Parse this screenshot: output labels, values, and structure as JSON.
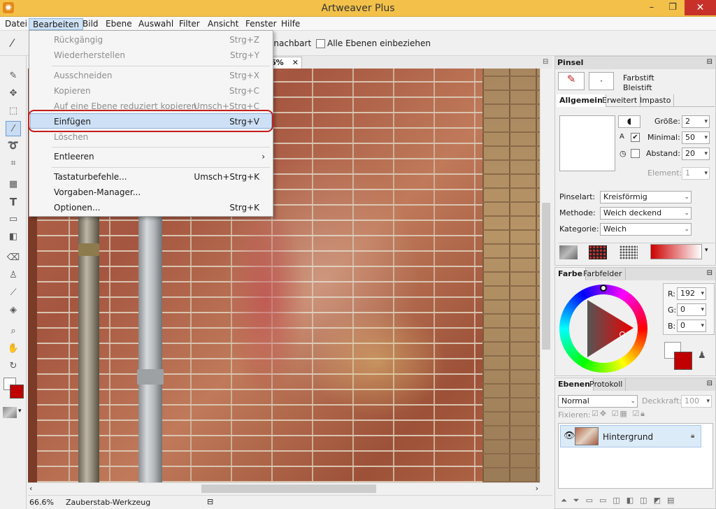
{
  "app": {
    "title": "Artweaver Plus"
  },
  "window_controls": {
    "minimize": "–",
    "maximize": "❐",
    "close": "✕"
  },
  "menubar": [
    "Datei",
    "Bearbeiten",
    "Bild",
    "Ebene",
    "Auswahl",
    "Filter",
    "Ansicht",
    "Fenster",
    "Hilfe"
  ],
  "options_bar": {
    "partial_label": "enachbart",
    "all_layers_label": "Alle Ebenen einbeziehen"
  },
  "document": {
    "tab_label": "6%",
    "close": "✕"
  },
  "status": {
    "zoom": "66.6%",
    "tool_name": "Zauberstab-Werkzeug"
  },
  "edit_menu": {
    "items": [
      {
        "label": "Rückgängig",
        "shortcut": "Strg+Z",
        "enabled": false
      },
      {
        "label": "Wiederherstellen",
        "shortcut": "Strg+Y",
        "enabled": false
      },
      {
        "label": "Ausschneiden",
        "shortcut": "Strg+X",
        "enabled": false
      },
      {
        "label": "Kopieren",
        "shortcut": "Strg+C",
        "enabled": false
      },
      {
        "label": "Auf eine Ebene reduziert kopieren",
        "shortcut": "Umsch+Strg+C",
        "enabled": false
      },
      {
        "label": "Einfügen",
        "shortcut": "Strg+V",
        "enabled": true,
        "highlighted": true
      },
      {
        "label": "Löschen",
        "shortcut": "",
        "enabled": false
      },
      {
        "label": "Entleeren",
        "shortcut": "›",
        "enabled": true
      },
      {
        "label": "Tastaturbefehle...",
        "shortcut": "Umsch+Strg+K",
        "enabled": true
      },
      {
        "label": "Vorgaben-Manager...",
        "shortcut": "",
        "enabled": true
      },
      {
        "label": "Optionen...",
        "shortcut": "Strg+K",
        "enabled": true
      }
    ]
  },
  "brush_panel": {
    "title": "Pinsel",
    "brush_category": "Farbstift",
    "brush_variant": "Bleistift",
    "tabs": [
      "Allgemein",
      "Erweitert",
      "Impasto"
    ],
    "size_label": "Größe:",
    "size_value": "2",
    "minimal_label": "Minimal:",
    "minimal_value": "50",
    "spacing_label": "Abstand:",
    "spacing_value": "20",
    "element_label": "Element:",
    "element_value": "1",
    "brush_type_label": "Pinselart:",
    "brush_type_value": "Kreisförmig",
    "method_label": "Methode:",
    "method_value": "Weich deckend",
    "category_label": "Kategorie:",
    "category_value": "Weich"
  },
  "color_panel": {
    "tabs": [
      "Farbe",
      "Farbfelder"
    ],
    "r_label": "R:",
    "r_value": "192",
    "g_label": "G:",
    "g_value": "0",
    "b_label": "B:",
    "b_value": "0",
    "foreground_color": "#c00000",
    "background_color": "#ffffff"
  },
  "layers_panel": {
    "tabs": [
      "Ebenen",
      "Protokoll"
    ],
    "blend_mode": "Normal",
    "opacity_label": "Deckkraft:",
    "opacity_value": "100",
    "lock_label": "Fixieren:",
    "layers": [
      {
        "name": "Hintergrund"
      }
    ]
  },
  "colors": {
    "accent_highlight": "#cde0f5",
    "callout_ring": "#c41e1e",
    "title_bar": "#f3c14a"
  }
}
